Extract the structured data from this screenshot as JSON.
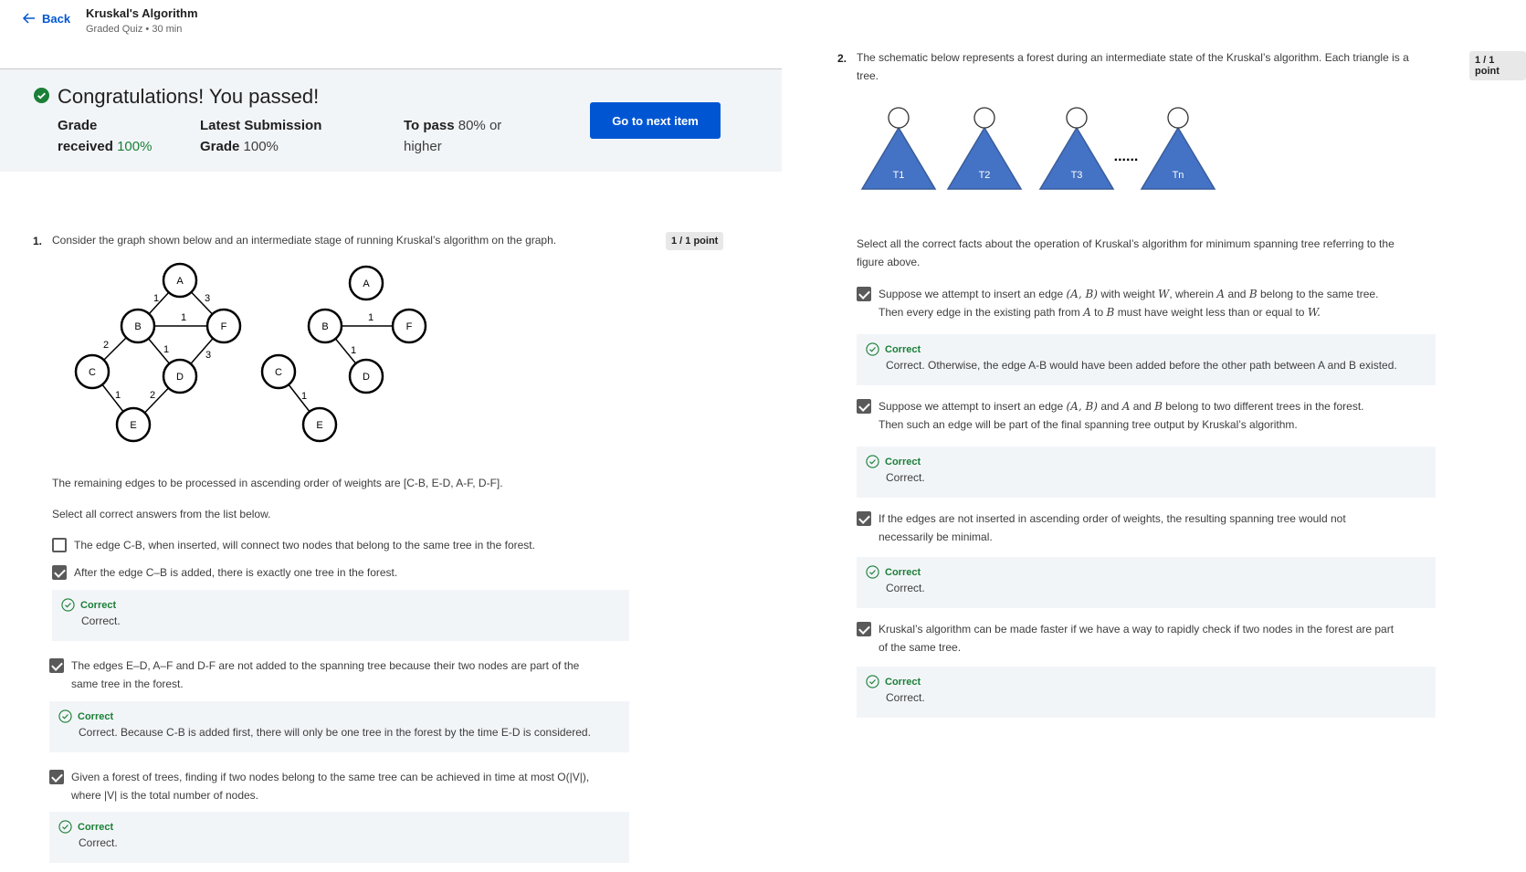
{
  "header": {
    "back_label": "Back",
    "title": "Kruskal's Algorithm",
    "subtitle": "Graded Quiz • 30 min"
  },
  "banner": {
    "title": "Congratulations! You passed!",
    "grade_label_1": "Grade",
    "grade_label_2": "received",
    "grade_value": "100%",
    "latest_label_1": "Latest Submission",
    "latest_label_2": "Grade",
    "latest_value": "100%",
    "pass_label": "To pass",
    "pass_value_1": "80% or",
    "pass_value_2": "higher",
    "next_button": "Go to next item"
  },
  "q1": {
    "number": "1.",
    "prompt": "Consider the graph shown below and an intermediate stage of running Kruskal’s algorithm on the graph.",
    "points": "1 / 1 point",
    "remaining": "The remaining edges to be processed in ascending order of weights are [C-B, E-D, A-F, D-F].",
    "instruction": "Select all correct answers from the list below.",
    "options": [
      "The edge C-B, when inserted, will connect two nodes that belong to the same tree in the forest.",
      "After the edge C–B is added, there is exactly one tree in the forest.",
      "The edges E–D, A–F and D-F are not added to the spanning tree because their two nodes are part of the",
      "same tree in the forest.",
      "Given a forest of trees, finding if two nodes belong to the same tree can be achieved in time at most O(|V|),",
      "where |V| is the total number of nodes."
    ],
    "feedback": [
      {
        "head": "Correct",
        "body": "Correct."
      },
      {
        "head": "Correct",
        "body": "Correct.  Because C-B is added first, there will only be one tree in the forest by the time E-D is considered."
      },
      {
        "head": "Correct",
        "body": "Correct."
      }
    ],
    "graph": {
      "nodes": [
        "A",
        "B",
        "C",
        "D",
        "E",
        "F"
      ],
      "weights": [
        "1",
        "3",
        "1",
        "2",
        "1",
        "3",
        "1",
        "2"
      ],
      "forest_weights": [
        "1",
        "1",
        "1"
      ]
    }
  },
  "q2": {
    "number": "2.",
    "prompt_1": "The schematic below represents a forest during an intermediate state of the Kruskal’s algorithm. Each triangle is a",
    "prompt_2": "tree.",
    "points": "1 / 1 point",
    "trees": [
      "T1",
      "T2",
      "T3",
      "Tn"
    ],
    "ellipsis": "......",
    "instruction_1": "Select all the correct facts about the operation of Kruskal’s algorithm for minimum spanning tree referring to the",
    "instruction_2": "figure above.",
    "opt1_a": "Suppose we attempt to insert an edge",
    "opt1_math1": "(A, B)",
    "opt1_b": "with weight",
    "opt1_math2": "W",
    "opt1_c": ", wherein",
    "opt1_math3": "A",
    "opt1_d": "and",
    "opt1_math4": "B",
    "opt1_e": "belong to the same tree.",
    "opt1_f": "Then every edge in the existing path from",
    "opt1_math5": "A",
    "opt1_g": "to",
    "opt1_math6": "B",
    "opt1_h": "must have weight less than or equal to",
    "opt1_math7": "W.",
    "opt2_a": "Suppose we attempt to insert an edge",
    "opt2_math1": "(A, B)",
    "opt2_b": "and",
    "opt2_math2": "A",
    "opt2_c": "and",
    "opt2_math3": "B",
    "opt2_d": "belong to two different trees in the forest.",
    "opt2_e": "Then such an edge will be part of the final spanning tree output by Kruskal’s algorithm.",
    "opt3_a": "If the edges are not inserted in ascending order of weights, the resulting spanning tree would not",
    "opt3_b": "necessarily be minimal.",
    "opt4_a": "Kruskal’s algorithm can be made faster if we have a way to rapidly check if two nodes in the forest are part",
    "opt4_b": "of the same tree.",
    "feedback": [
      {
        "head": "Correct",
        "body": "Correct. Otherwise, the edge A-B would have been added before the other path between A and B existed."
      },
      {
        "head": "Correct",
        "body": "Correct."
      },
      {
        "head": "Correct",
        "body": "Correct."
      },
      {
        "head": "Correct",
        "body": "Correct."
      }
    ]
  },
  "colors": {
    "accent": "#0056d2",
    "success": "#1a7f37",
    "triangle": "#4472c4"
  }
}
